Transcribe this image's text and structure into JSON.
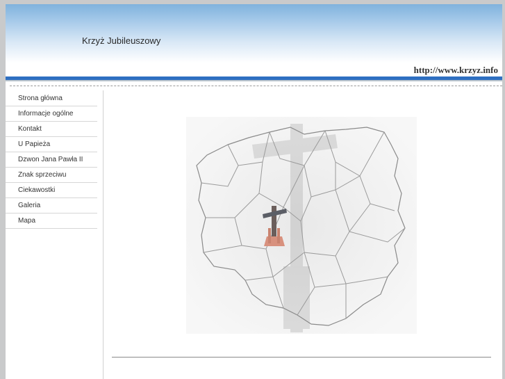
{
  "header": {
    "site_title": "Krzyż Jubileuszowy",
    "url": "http://www.krzyz.info"
  },
  "sidebar": {
    "items": [
      {
        "label": "Strona główna"
      },
      {
        "label": "Informacje ogólne"
      },
      {
        "label": "Kontakt"
      },
      {
        "label": "U Papieża"
      },
      {
        "label": "Dzwon Jana Pawła II"
      },
      {
        "label": "Znak sprzeciwu"
      },
      {
        "label": "Ciekawostki"
      },
      {
        "label": "Galeria"
      },
      {
        "label": "Mapa"
      }
    ]
  },
  "colors": {
    "accent_line": "#2e6fc1",
    "header_gradient_top": "#7fb2dd"
  }
}
